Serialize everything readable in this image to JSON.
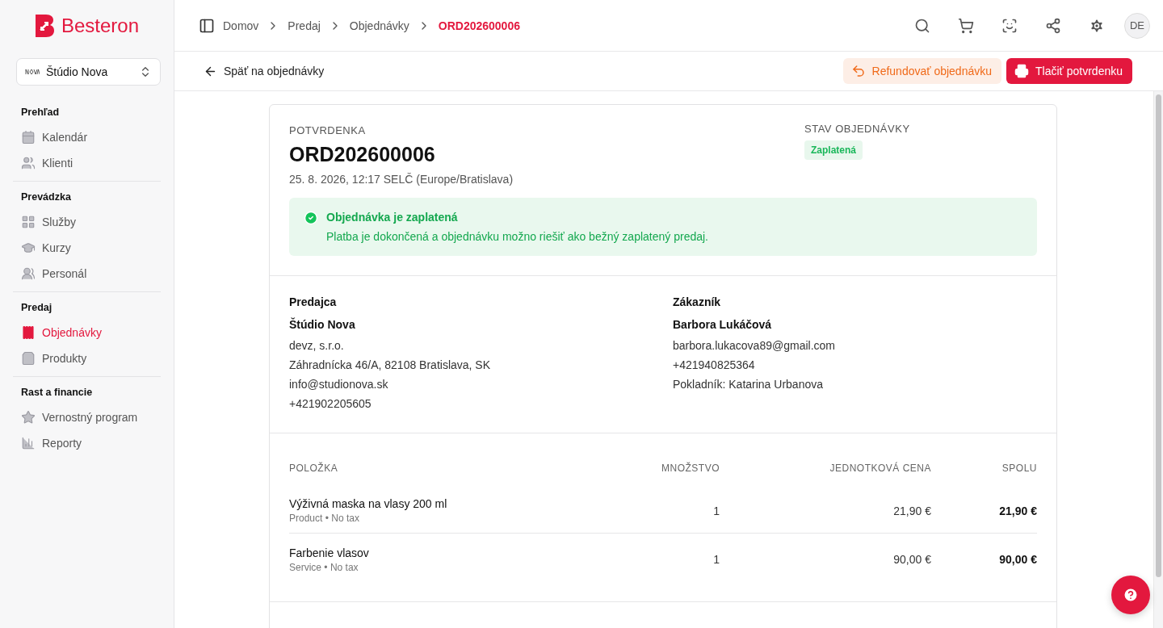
{
  "brand": {
    "name": "Besteron"
  },
  "workspace": {
    "name": "Štúdio Nova"
  },
  "sidebar": {
    "sections": [
      {
        "title": "Prehľad",
        "items": [
          {
            "label": "Kalendár",
            "selected": false
          },
          {
            "label": "Klienti",
            "selected": false
          }
        ]
      },
      {
        "title": "Prevádzka",
        "items": [
          {
            "label": "Služby",
            "selected": false
          },
          {
            "label": "Kurzy",
            "selected": false
          },
          {
            "label": "Personál",
            "selected": false
          }
        ]
      },
      {
        "title": "Predaj",
        "items": [
          {
            "label": "Objednávky",
            "selected": true
          },
          {
            "label": "Produkty",
            "selected": false
          }
        ]
      },
      {
        "title": "Rast a financie",
        "items": [
          {
            "label": "Vernostný program",
            "selected": false
          },
          {
            "label": "Reporty",
            "selected": false
          }
        ]
      }
    ]
  },
  "breadcrumb": [
    {
      "label": "Domov",
      "current": false
    },
    {
      "label": "Predaj",
      "current": false
    },
    {
      "label": "Objednávky",
      "current": false
    },
    {
      "label": "ORD202600006",
      "current": true
    }
  ],
  "user": {
    "initials": "DE"
  },
  "back_link": "Späť na objednávky",
  "actions": [
    {
      "label": "Refundovať objednávku",
      "kind": "refund"
    },
    {
      "label": "Tlačiť potvrdenku",
      "kind": "print"
    }
  ],
  "receipt": {
    "eyebrow": "POTVRDENKA",
    "number": "ORD202600006",
    "date": "25. 8. 2026, 12:17 SELČ (Europe/Bratislava)",
    "status_label": "STAV OBJEDNÁVKY",
    "status": "Zaplatená",
    "alert": {
      "title": "Objednávka je zaplatená",
      "text": "Platba je dokončená a objednávku možno riešiť ako bežný zaplatený predaj."
    },
    "parties": [
      {
        "heading": "Predajca",
        "name": "Štúdio Nova",
        "lines": [
          "devz, s.r.o.",
          "Záhradnícka 46/A, 82108 Bratislava, SK",
          "info@studionova.sk",
          "+421902205605"
        ]
      },
      {
        "heading": "Zákazník",
        "name": "Barbora Lukáčová",
        "lines": [
          "barbora.lukacova89@gmail.com",
          "+421940825364",
          "Pokladník: Katarina Urbanova"
        ]
      }
    ],
    "items": {
      "columns": [
        "POLOŽKA",
        "MNOŽSTVO",
        "JEDNOTKOVÁ CENA",
        "SPOLU"
      ],
      "rows": [
        {
          "name": "Výživná maska na vlasy 200 ml",
          "meta": "Product • No tax",
          "quantity": "1",
          "unit_price": "21,90 €",
          "total": "21,90 €"
        },
        {
          "name": "Farbenie vlasov",
          "meta": "Service • No tax",
          "quantity": "1",
          "unit_price": "90,00 €",
          "total": "90,00 €"
        }
      ]
    }
  }
}
